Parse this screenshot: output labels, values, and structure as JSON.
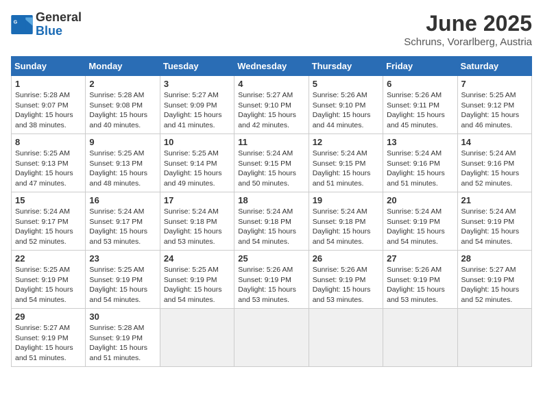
{
  "logo": {
    "line1": "General",
    "line2": "Blue"
  },
  "title": "June 2025",
  "location": "Schruns, Vorarlberg, Austria",
  "weekdays": [
    "Sunday",
    "Monday",
    "Tuesday",
    "Wednesday",
    "Thursday",
    "Friday",
    "Saturday"
  ],
  "weeks": [
    [
      {
        "day": "1",
        "sunrise": "5:28 AM",
        "sunset": "9:07 PM",
        "daylight": "15 hours and 38 minutes."
      },
      {
        "day": "2",
        "sunrise": "5:28 AM",
        "sunset": "9:08 PM",
        "daylight": "15 hours and 40 minutes."
      },
      {
        "day": "3",
        "sunrise": "5:27 AM",
        "sunset": "9:09 PM",
        "daylight": "15 hours and 41 minutes."
      },
      {
        "day": "4",
        "sunrise": "5:27 AM",
        "sunset": "9:10 PM",
        "daylight": "15 hours and 42 minutes."
      },
      {
        "day": "5",
        "sunrise": "5:26 AM",
        "sunset": "9:10 PM",
        "daylight": "15 hours and 44 minutes."
      },
      {
        "day": "6",
        "sunrise": "5:26 AM",
        "sunset": "9:11 PM",
        "daylight": "15 hours and 45 minutes."
      },
      {
        "day": "7",
        "sunrise": "5:25 AM",
        "sunset": "9:12 PM",
        "daylight": "15 hours and 46 minutes."
      }
    ],
    [
      {
        "day": "8",
        "sunrise": "5:25 AM",
        "sunset": "9:13 PM",
        "daylight": "15 hours and 47 minutes."
      },
      {
        "day": "9",
        "sunrise": "5:25 AM",
        "sunset": "9:13 PM",
        "daylight": "15 hours and 48 minutes."
      },
      {
        "day": "10",
        "sunrise": "5:25 AM",
        "sunset": "9:14 PM",
        "daylight": "15 hours and 49 minutes."
      },
      {
        "day": "11",
        "sunrise": "5:24 AM",
        "sunset": "9:15 PM",
        "daylight": "15 hours and 50 minutes."
      },
      {
        "day": "12",
        "sunrise": "5:24 AM",
        "sunset": "9:15 PM",
        "daylight": "15 hours and 51 minutes."
      },
      {
        "day": "13",
        "sunrise": "5:24 AM",
        "sunset": "9:16 PM",
        "daylight": "15 hours and 51 minutes."
      },
      {
        "day": "14",
        "sunrise": "5:24 AM",
        "sunset": "9:16 PM",
        "daylight": "15 hours and 52 minutes."
      }
    ],
    [
      {
        "day": "15",
        "sunrise": "5:24 AM",
        "sunset": "9:17 PM",
        "daylight": "15 hours and 52 minutes."
      },
      {
        "day": "16",
        "sunrise": "5:24 AM",
        "sunset": "9:17 PM",
        "daylight": "15 hours and 53 minutes."
      },
      {
        "day": "17",
        "sunrise": "5:24 AM",
        "sunset": "9:18 PM",
        "daylight": "15 hours and 53 minutes."
      },
      {
        "day": "18",
        "sunrise": "5:24 AM",
        "sunset": "9:18 PM",
        "daylight": "15 hours and 54 minutes."
      },
      {
        "day": "19",
        "sunrise": "5:24 AM",
        "sunset": "9:18 PM",
        "daylight": "15 hours and 54 minutes."
      },
      {
        "day": "20",
        "sunrise": "5:24 AM",
        "sunset": "9:19 PM",
        "daylight": "15 hours and 54 minutes."
      },
      {
        "day": "21",
        "sunrise": "5:24 AM",
        "sunset": "9:19 PM",
        "daylight": "15 hours and 54 minutes."
      }
    ],
    [
      {
        "day": "22",
        "sunrise": "5:25 AM",
        "sunset": "9:19 PM",
        "daylight": "15 hours and 54 minutes."
      },
      {
        "day": "23",
        "sunrise": "5:25 AM",
        "sunset": "9:19 PM",
        "daylight": "15 hours and 54 minutes."
      },
      {
        "day": "24",
        "sunrise": "5:25 AM",
        "sunset": "9:19 PM",
        "daylight": "15 hours and 54 minutes."
      },
      {
        "day": "25",
        "sunrise": "5:26 AM",
        "sunset": "9:19 PM",
        "daylight": "15 hours and 53 minutes."
      },
      {
        "day": "26",
        "sunrise": "5:26 AM",
        "sunset": "9:19 PM",
        "daylight": "15 hours and 53 minutes."
      },
      {
        "day": "27",
        "sunrise": "5:26 AM",
        "sunset": "9:19 PM",
        "daylight": "15 hours and 53 minutes."
      },
      {
        "day": "28",
        "sunrise": "5:27 AM",
        "sunset": "9:19 PM",
        "daylight": "15 hours and 52 minutes."
      }
    ],
    [
      {
        "day": "29",
        "sunrise": "5:27 AM",
        "sunset": "9:19 PM",
        "daylight": "15 hours and 51 minutes."
      },
      {
        "day": "30",
        "sunrise": "5:28 AM",
        "sunset": "9:19 PM",
        "daylight": "15 hours and 51 minutes."
      },
      null,
      null,
      null,
      null,
      null
    ]
  ],
  "labels": {
    "sunrise": "Sunrise: ",
    "sunset": "Sunset: ",
    "daylight": "Daylight: "
  }
}
